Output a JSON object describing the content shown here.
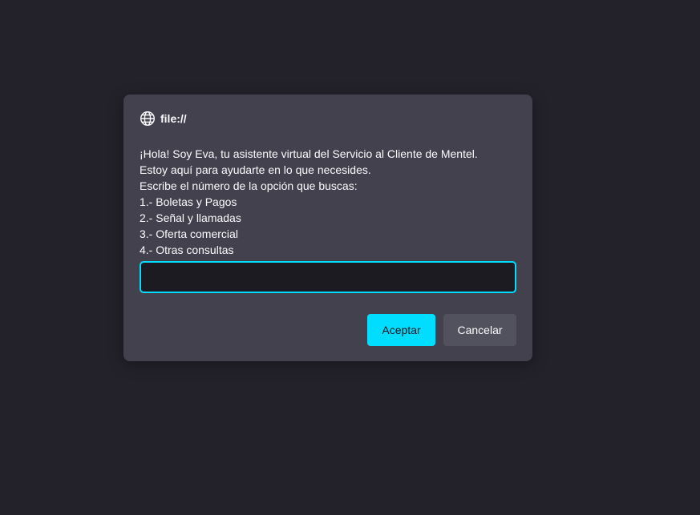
{
  "dialog": {
    "origin_icon": "globe-icon",
    "origin_label": "file://",
    "message_lines": [
      "¡Hola! Soy Eva, tu asistente virtual del Servicio al Cliente de Mentel.",
      "Estoy aquí para ayudarte en lo que necesides.",
      "Escribe el número de la opción que buscas:",
      "1.- Boletas y Pagos",
      "2.- Señal y llamadas",
      "3.- Oferta comercial",
      "4.- Otras consultas"
    ],
    "input_value": "",
    "accept_label": "Aceptar",
    "cancel_label": "Cancelar"
  },
  "colors": {
    "page_background": "#23222b",
    "dialog_background": "#42414d",
    "accent": "#00ddff",
    "input_background": "#1c1b22",
    "secondary_button": "#52515e"
  }
}
